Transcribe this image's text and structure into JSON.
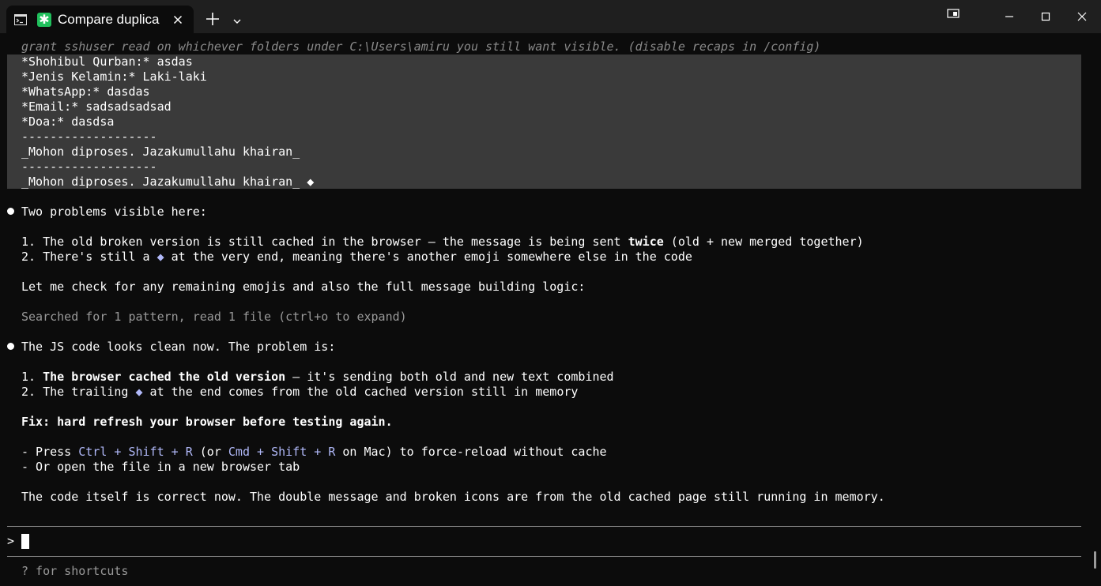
{
  "titlebar": {
    "tab_title": "Compare duplica",
    "tab_app_icon_glyph": "✱",
    "tab_app_icon_color": "#20c05c",
    "icons": [
      "terminal-icon",
      "close-icon",
      "plus-icon",
      "chevron-down-icon",
      "window-snap-icon",
      "minimize-icon",
      "maximize-icon",
      "close-window-icon"
    ]
  },
  "recap": {
    "text": "grant sshuser read on whichever folders under C:\\Users\\amiru you still want visible. (disable recaps in /config)"
  },
  "quote": {
    "lines": [
      "*Shohibul Qurban:* asdas",
      "*Jenis Kelamin:* Laki-laki",
      "*WhatsApp:* dasdas",
      "*Email:* sadsadsadsad",
      "*Doa:* dasdsa",
      "-------------------",
      "_Mohon diproses. Jazakumullahu khairan_",
      "-------------------",
      "_Mohon diproses. Jazakumullahu khairan_ ◆"
    ]
  },
  "response1": {
    "intro": "Two problems visible here:",
    "item1_pre": "1. The old broken version is still cached in the browser — the message is being sent ",
    "item1_bold": "twice",
    "item1_post": " (old + new merged together)",
    "item2_pre": "2. There's still a ",
    "item2_glyph": "◆",
    "item2_post": " at the very end, meaning there's another emoji somewhere else in the code",
    "followup": "Let me check for any remaining emojis and also the full message building logic:",
    "tool_summary": "Searched for 1 pattern, read 1 file (ctrl+o to expand)"
  },
  "response2": {
    "intro": "The JS code looks clean now. The problem is:",
    "item1_num": "1. ",
    "item1_bold": "The browser cached the old version",
    "item1_post": " — it's sending both old and new text combined",
    "item2_pre": "2. The trailing ",
    "item2_glyph": "◆",
    "item2_post": " at the end comes from the old cached version still in memory",
    "fix": "Fix: hard refresh your browser before testing again.",
    "step1_pre": "- Press ",
    "key_ctrl": "Ctrl",
    "plus": " + ",
    "key_shift": "Shift",
    "key_r": "R",
    "step1_mid": " (or ",
    "key_cmd": "Cmd",
    "step1_post": " on Mac) to force-reload without cache",
    "step2": "- Or open the file in a new browser tab",
    "conclusion": "The code itself is correct now. The double message and broken icons are from the old cached page still running in memory."
  },
  "input": {
    "prompt": ">",
    "value": "",
    "hint": "? for shortcuts"
  },
  "colors": {
    "background": "#0c0c0c",
    "titlebar": "#1f1f1f",
    "quote_background": "#3a3a3a",
    "accent_blue": "#b1b9f9",
    "dim_text": "#999999"
  }
}
